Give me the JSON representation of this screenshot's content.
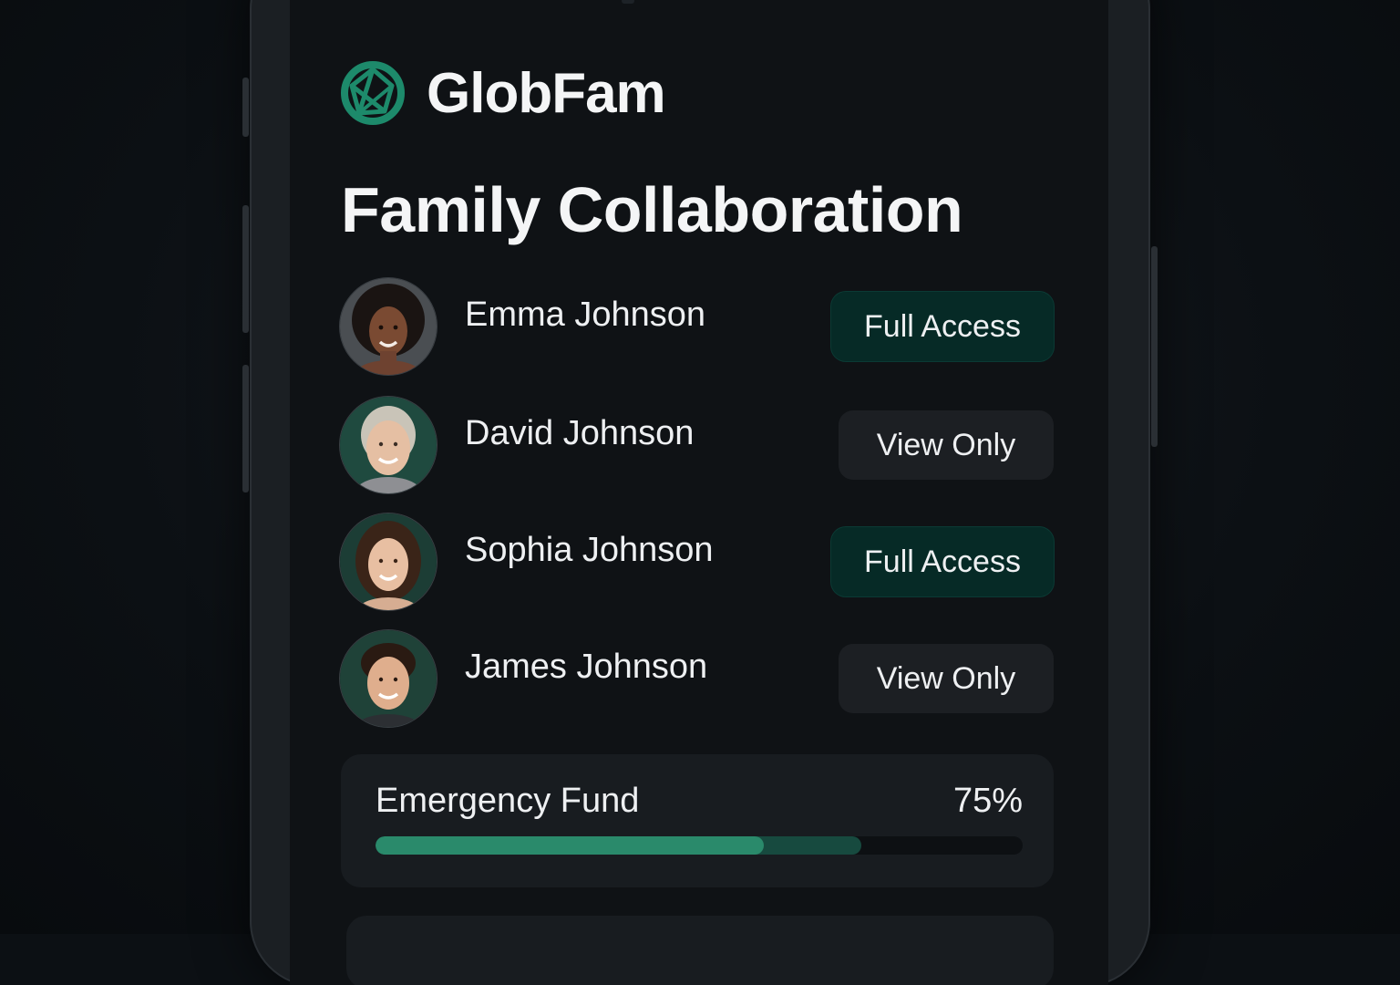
{
  "brand": {
    "name": "GlobFam",
    "logo_icon": "globe-network-icon",
    "accent": "#1d8a6b"
  },
  "page": {
    "title": "Family Collaboration"
  },
  "members": [
    {
      "name": "Emma Johnson",
      "access": "Full Access",
      "access_type": "full",
      "avatar": "avatar-emma"
    },
    {
      "name": "David Johnson",
      "access": "View Only",
      "access_type": "view",
      "avatar": "avatar-david"
    },
    {
      "name": "Sophia Johnson",
      "access": "Full Access",
      "access_type": "full",
      "avatar": "avatar-sophia"
    },
    {
      "name": "James Johnson",
      "access": "View Only",
      "access_type": "view",
      "avatar": "avatar-james"
    }
  ],
  "fund": {
    "label": "Emergency Fund",
    "percent_label": "75%",
    "progress": 0.75,
    "fill_color": "#2a8a6b"
  }
}
